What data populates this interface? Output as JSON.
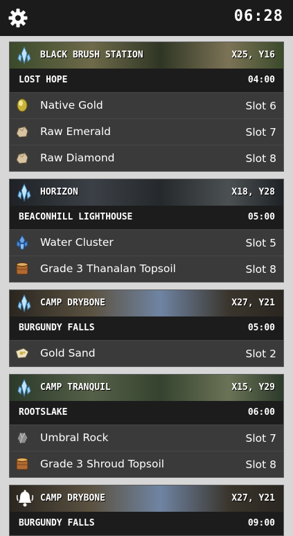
{
  "header": {
    "time": "06:28"
  },
  "cards": [
    {
      "location": "BLACK BRUSH STATION",
      "coords": "X25, Y16",
      "area": "LOST HOPE",
      "time": "04:00",
      "bell": false,
      "banner_colors": [
        "#3a4a2a",
        "#6e6a4a",
        "#2f3624",
        "#7c7356"
      ],
      "items": [
        {
          "name": "Native Gold",
          "slot": "Slot 6",
          "icon": "gold-ore-icon"
        },
        {
          "name": "Raw Emerald",
          "slot": "Slot 7",
          "icon": "rough-stone-icon"
        },
        {
          "name": "Raw Diamond",
          "slot": "Slot 8",
          "icon": "rough-stone-icon"
        }
      ]
    },
    {
      "location": "HORIZON",
      "coords": "X18, Y28",
      "area": "BEACONHILL LIGHTHOUSE",
      "time": "05:00",
      "bell": false,
      "banner_colors": [
        "#1e2226",
        "#3b4046",
        "#25292c",
        "#4b5052"
      ],
      "items": [
        {
          "name": "Water Cluster",
          "slot": "Slot 5",
          "icon": "water-cluster-icon"
        },
        {
          "name": "Grade 3 Thanalan Topsoil",
          "slot": "Slot 8",
          "icon": "topsoil-icon"
        }
      ]
    },
    {
      "location": "CAMP DRYBONE",
      "coords": "X27, Y21",
      "area": "BURGUNDY FALLS",
      "time": "05:00",
      "bell": false,
      "banner_colors": [
        "#2a2620",
        "#5b5241",
        "#6f84a3",
        "#3a352c"
      ],
      "items": [
        {
          "name": "Gold Sand",
          "slot": "Slot 2",
          "icon": "gold-sand-icon"
        }
      ]
    },
    {
      "location": "CAMP TRANQUIL",
      "coords": "X15, Y29",
      "area": "ROOTSLAKE",
      "time": "06:00",
      "bell": false,
      "banner_colors": [
        "#2c3a2a",
        "#556048",
        "#35432f",
        "#6a7356"
      ],
      "items": [
        {
          "name": "Umbral Rock",
          "slot": "Slot 7",
          "icon": "umbral-rock-icon"
        },
        {
          "name": "Grade 3 Shroud Topsoil",
          "slot": "Slot 8",
          "icon": "topsoil-icon"
        }
      ]
    },
    {
      "location": "CAMP DRYBONE",
      "coords": "X27, Y21",
      "area": "BURGUNDY FALLS",
      "time": "09:00",
      "bell": true,
      "banner_colors": [
        "#2a2620",
        "#5b5241",
        "#6f84a3",
        "#3a352c"
      ],
      "items": []
    }
  ]
}
